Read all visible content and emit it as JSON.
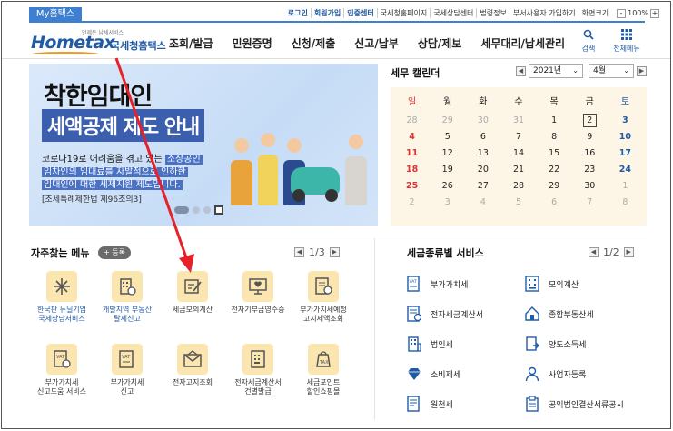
{
  "topbar": {
    "my_tab": "My홈택스",
    "links": [
      {
        "label": "로그인",
        "style": "blue"
      },
      {
        "label": "회원가입",
        "style": "blue"
      },
      {
        "label": "인증센터",
        "style": "blue"
      },
      {
        "label": "국세청홈페이지",
        "style": "normal"
      },
      {
        "label": "국세상담센터",
        "style": "normal"
      },
      {
        "label": "법령정보",
        "style": "normal"
      },
      {
        "label": "부서사용자 가입하기",
        "style": "normal"
      },
      {
        "label": "화면크기",
        "style": "normal"
      }
    ],
    "zoom_minus": "-",
    "zoom_value": "100%",
    "zoom_plus": "+"
  },
  "header": {
    "logo_word": "Hometax",
    "logo_sub": "언제든 납세서비스",
    "logo_kr": "국세청홈택스",
    "nav": [
      "조회/발급",
      "민원증명",
      "신청/제출",
      "신고/납부",
      "상담/제보",
      "세무대리/납세관리"
    ],
    "search_label": "검색",
    "menu_label": "전체메뉴"
  },
  "banner": {
    "title1": "착한임대인",
    "title2": "세액공제 제도 안내",
    "desc1_pre": "코로나19로 어려움을 겪고 있는 ",
    "desc1_hl": "소상공인",
    "desc2": "임차인의 임대료를 자발적으로 인하한",
    "desc3": "임대인에 대한 세제지원 제도입니다.",
    "ref": "[조세특례제한법 제96조의3]"
  },
  "calendar": {
    "title": "세무 캘린더",
    "year": "2021년",
    "month": "4월",
    "weekdays": [
      "일",
      "월",
      "화",
      "수",
      "목",
      "금",
      "토"
    ],
    "weeks": [
      [
        {
          "d": "28",
          "o": true
        },
        {
          "d": "29",
          "o": true
        },
        {
          "d": "30",
          "o": true
        },
        {
          "d": "31",
          "o": true
        },
        {
          "d": "1"
        },
        {
          "d": "2",
          "today": true
        },
        {
          "d": "3",
          "b": true
        }
      ],
      [
        {
          "d": "4",
          "b": true
        },
        {
          "d": "5"
        },
        {
          "d": "6"
        },
        {
          "d": "7"
        },
        {
          "d": "8"
        },
        {
          "d": "9"
        },
        {
          "d": "10",
          "b": true
        }
      ],
      [
        {
          "d": "11",
          "b": true
        },
        {
          "d": "12"
        },
        {
          "d": "13"
        },
        {
          "d": "14"
        },
        {
          "d": "15"
        },
        {
          "d": "16"
        },
        {
          "d": "17",
          "b": true
        }
      ],
      [
        {
          "d": "18",
          "b": true
        },
        {
          "d": "19"
        },
        {
          "d": "20"
        },
        {
          "d": "21"
        },
        {
          "d": "22"
        },
        {
          "d": "23"
        },
        {
          "d": "24",
          "b": true
        }
      ],
      [
        {
          "d": "25",
          "b": true
        },
        {
          "d": "26"
        },
        {
          "d": "27"
        },
        {
          "d": "28"
        },
        {
          "d": "29"
        },
        {
          "d": "30"
        },
        {
          "d": "1",
          "o": true
        }
      ],
      [
        {
          "d": "2",
          "o": true
        },
        {
          "d": "3",
          "o": true
        },
        {
          "d": "4",
          "o": true
        },
        {
          "d": "5",
          "o": true
        },
        {
          "d": "6",
          "o": true
        },
        {
          "d": "7",
          "o": true
        },
        {
          "d": "8",
          "o": true
        }
      ]
    ]
  },
  "frequent": {
    "title": "자주찾는 메뉴",
    "add_label": "+ 등록",
    "page": "1/3",
    "items": [
      {
        "label": "한국판 뉴딜기업\n국세상담서비스",
        "icon": "sparkle-icon",
        "blue": true
      },
      {
        "label": "개발지역 부동산\n탈세신고",
        "icon": "building-report-icon",
        "blue": true
      },
      {
        "label": "세금모의계산",
        "icon": "calculator-pen-icon",
        "blue": false
      },
      {
        "label": "전자기부금영수증",
        "icon": "monitor-heart-icon",
        "blue": false
      },
      {
        "label": "부가가치세예정\n고지세액조회",
        "icon": "tax-document-icon",
        "blue": false
      },
      {
        "label": "부가가치세\n신고도움 서비스",
        "icon": "vat-help-icon",
        "blue": false
      },
      {
        "label": "부가가치세\n신고",
        "icon": "vat-icon",
        "blue": false
      },
      {
        "label": "전자고지조회",
        "icon": "envelope-icon",
        "blue": false
      },
      {
        "label": "전자세금계산서\n건별발급",
        "icon": "invoice-calculator-icon",
        "blue": false
      },
      {
        "label": "세금포인트\n할인쇼핑몰",
        "icon": "shopping-tag-icon",
        "blue": false
      }
    ]
  },
  "services": {
    "title": "세금종류별 서비스",
    "page": "1/2",
    "items": [
      {
        "label": "부가가치세",
        "icon": "vat-doc-icon"
      },
      {
        "label": "모의계산",
        "icon": "calculator-icon"
      },
      {
        "label": "전자세금계산서",
        "icon": "e-invoice-icon"
      },
      {
        "label": "종합부동산세",
        "icon": "real-estate-icon"
      },
      {
        "label": "법인세",
        "icon": "corporation-icon"
      },
      {
        "label": "양도소득세",
        "icon": "transfer-icon"
      },
      {
        "label": "소비제세",
        "icon": "diamond-icon"
      },
      {
        "label": "사업자등록",
        "icon": "person-icon"
      },
      {
        "label": "원천세",
        "icon": "withholding-icon"
      },
      {
        "label": "공익법인결산서류공시",
        "icon": "public-notice-icon"
      }
    ]
  },
  "colors": {
    "brand_blue": "#1f5ba7",
    "accent_orange": "#f39a1c",
    "arrow_red": "#e5212a",
    "calendar_bg": "#fdf6e6",
    "icon_tile": "#fbe6b0"
  }
}
